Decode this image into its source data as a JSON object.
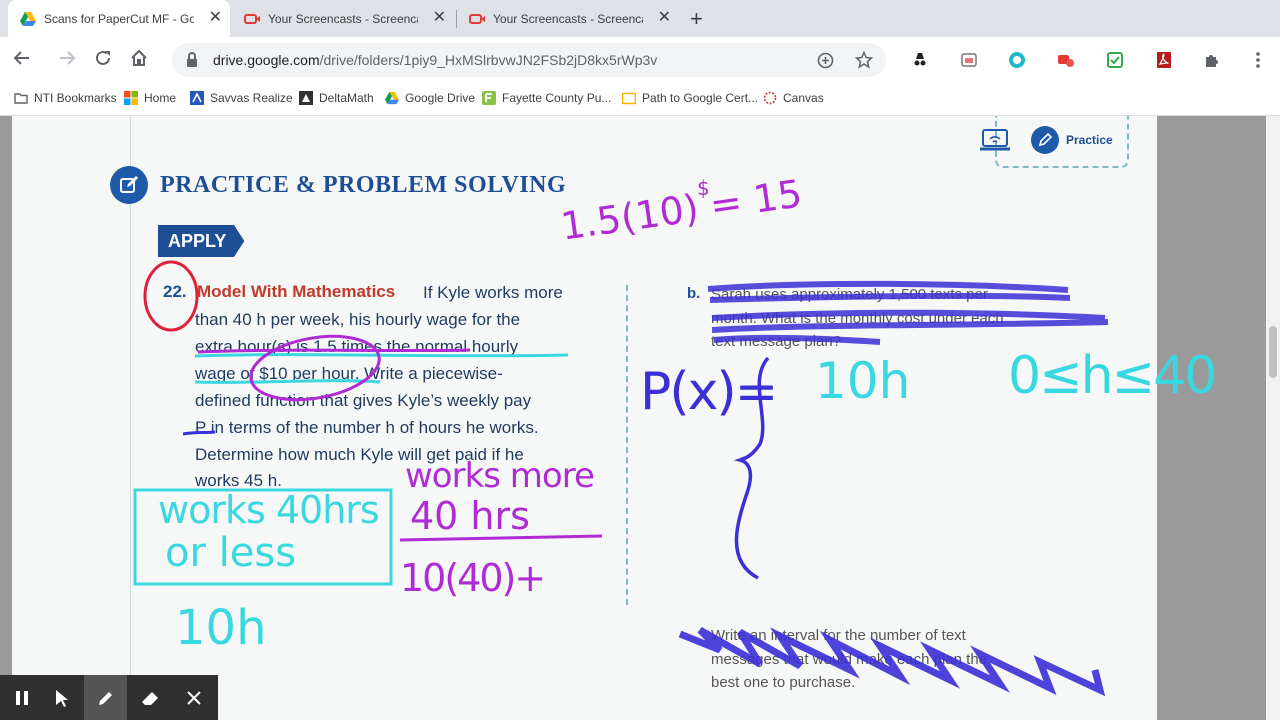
{
  "tabs": [
    {
      "title": "Scans for PaperCut MF - Goog",
      "icon": "google-drive-icon",
      "active": true
    },
    {
      "title": "Your Screencasts - Screencast",
      "icon": "screencastify-icon",
      "active": false
    },
    {
      "title": "Your Screencasts - Screencast",
      "icon": "screencastify-icon",
      "active": false
    }
  ],
  "toolbar": {
    "url_host": "drive.google.com",
    "url_path": "/drive/folders/1piy9_HxMSlrbvwJN2FSb2jD8kx5rWp3v"
  },
  "bookmarks": [
    {
      "label": "NTI Bookmarks",
      "icon": "folder-icon"
    },
    {
      "label": "Home",
      "icon": "windows-icon"
    },
    {
      "label": "Savvas Realize",
      "icon": "savvas-icon"
    },
    {
      "label": "DeltaMath",
      "icon": "deltamath-icon"
    },
    {
      "label": "Google Drive",
      "icon": "google-drive-icon"
    },
    {
      "label": "Fayette County Pu...",
      "icon": "fayette-icon"
    },
    {
      "label": "Path to Google Cert...",
      "icon": "folder-yellow-icon"
    },
    {
      "label": "Canvas",
      "icon": "canvas-icon"
    }
  ],
  "page": {
    "heading": "PRACTICE & PROBLEM SOLVING",
    "apply_label": "APPLY",
    "practice_label": "Practice",
    "problem_number": "22.",
    "problem_title": "Model With Mathematics",
    "problem_lines": [
      "If Kyle works more",
      "than 40 h per week, his hourly wage for the",
      "extra hour(s) is 1.5 times the normal hourly",
      "wage of $10 per hour. Write a piecewise-",
      "defined function that gives Kyle’s weekly pay",
      "P in terms of the number h of hours he works.",
      "Determine how much Kyle will get paid if he",
      "works 45 h."
    ],
    "part_b_label": "b.",
    "part_b_lines": [
      "Sarah uses approximately 1,500 texts per",
      "month. What is the monthly cost under each",
      "text message plan?"
    ],
    "part_c_lines": [
      "Write an interval for the number of text",
      "messages that would make each plan the",
      "best one to purchase."
    ]
  },
  "annotations": {
    "calc": "1.5(10) = 15",
    "calc_unit": "$",
    "box_left": [
      "works 40hrs",
      "or less"
    ],
    "left_expr": "10h",
    "right_header": [
      "works more",
      "40 hrs"
    ],
    "right_expr": "10(40)+",
    "function_label": "P(x)=",
    "piece_one": "10h",
    "domain_one": "0≤h≤40",
    "colors": {
      "cyan": "#39d7e0",
      "purple": "#b02bd6",
      "blue": "#3b2fd6",
      "red": "#e0203a"
    }
  },
  "screencast_controls": [
    {
      "name": "pause-button",
      "icon": "pause-icon"
    },
    {
      "name": "cursor-button",
      "icon": "cursor-icon"
    },
    {
      "name": "pen-button",
      "icon": "pen-icon"
    },
    {
      "name": "eraser-button",
      "icon": "eraser-icon"
    },
    {
      "name": "close-annotation-button",
      "icon": "close-icon"
    }
  ]
}
